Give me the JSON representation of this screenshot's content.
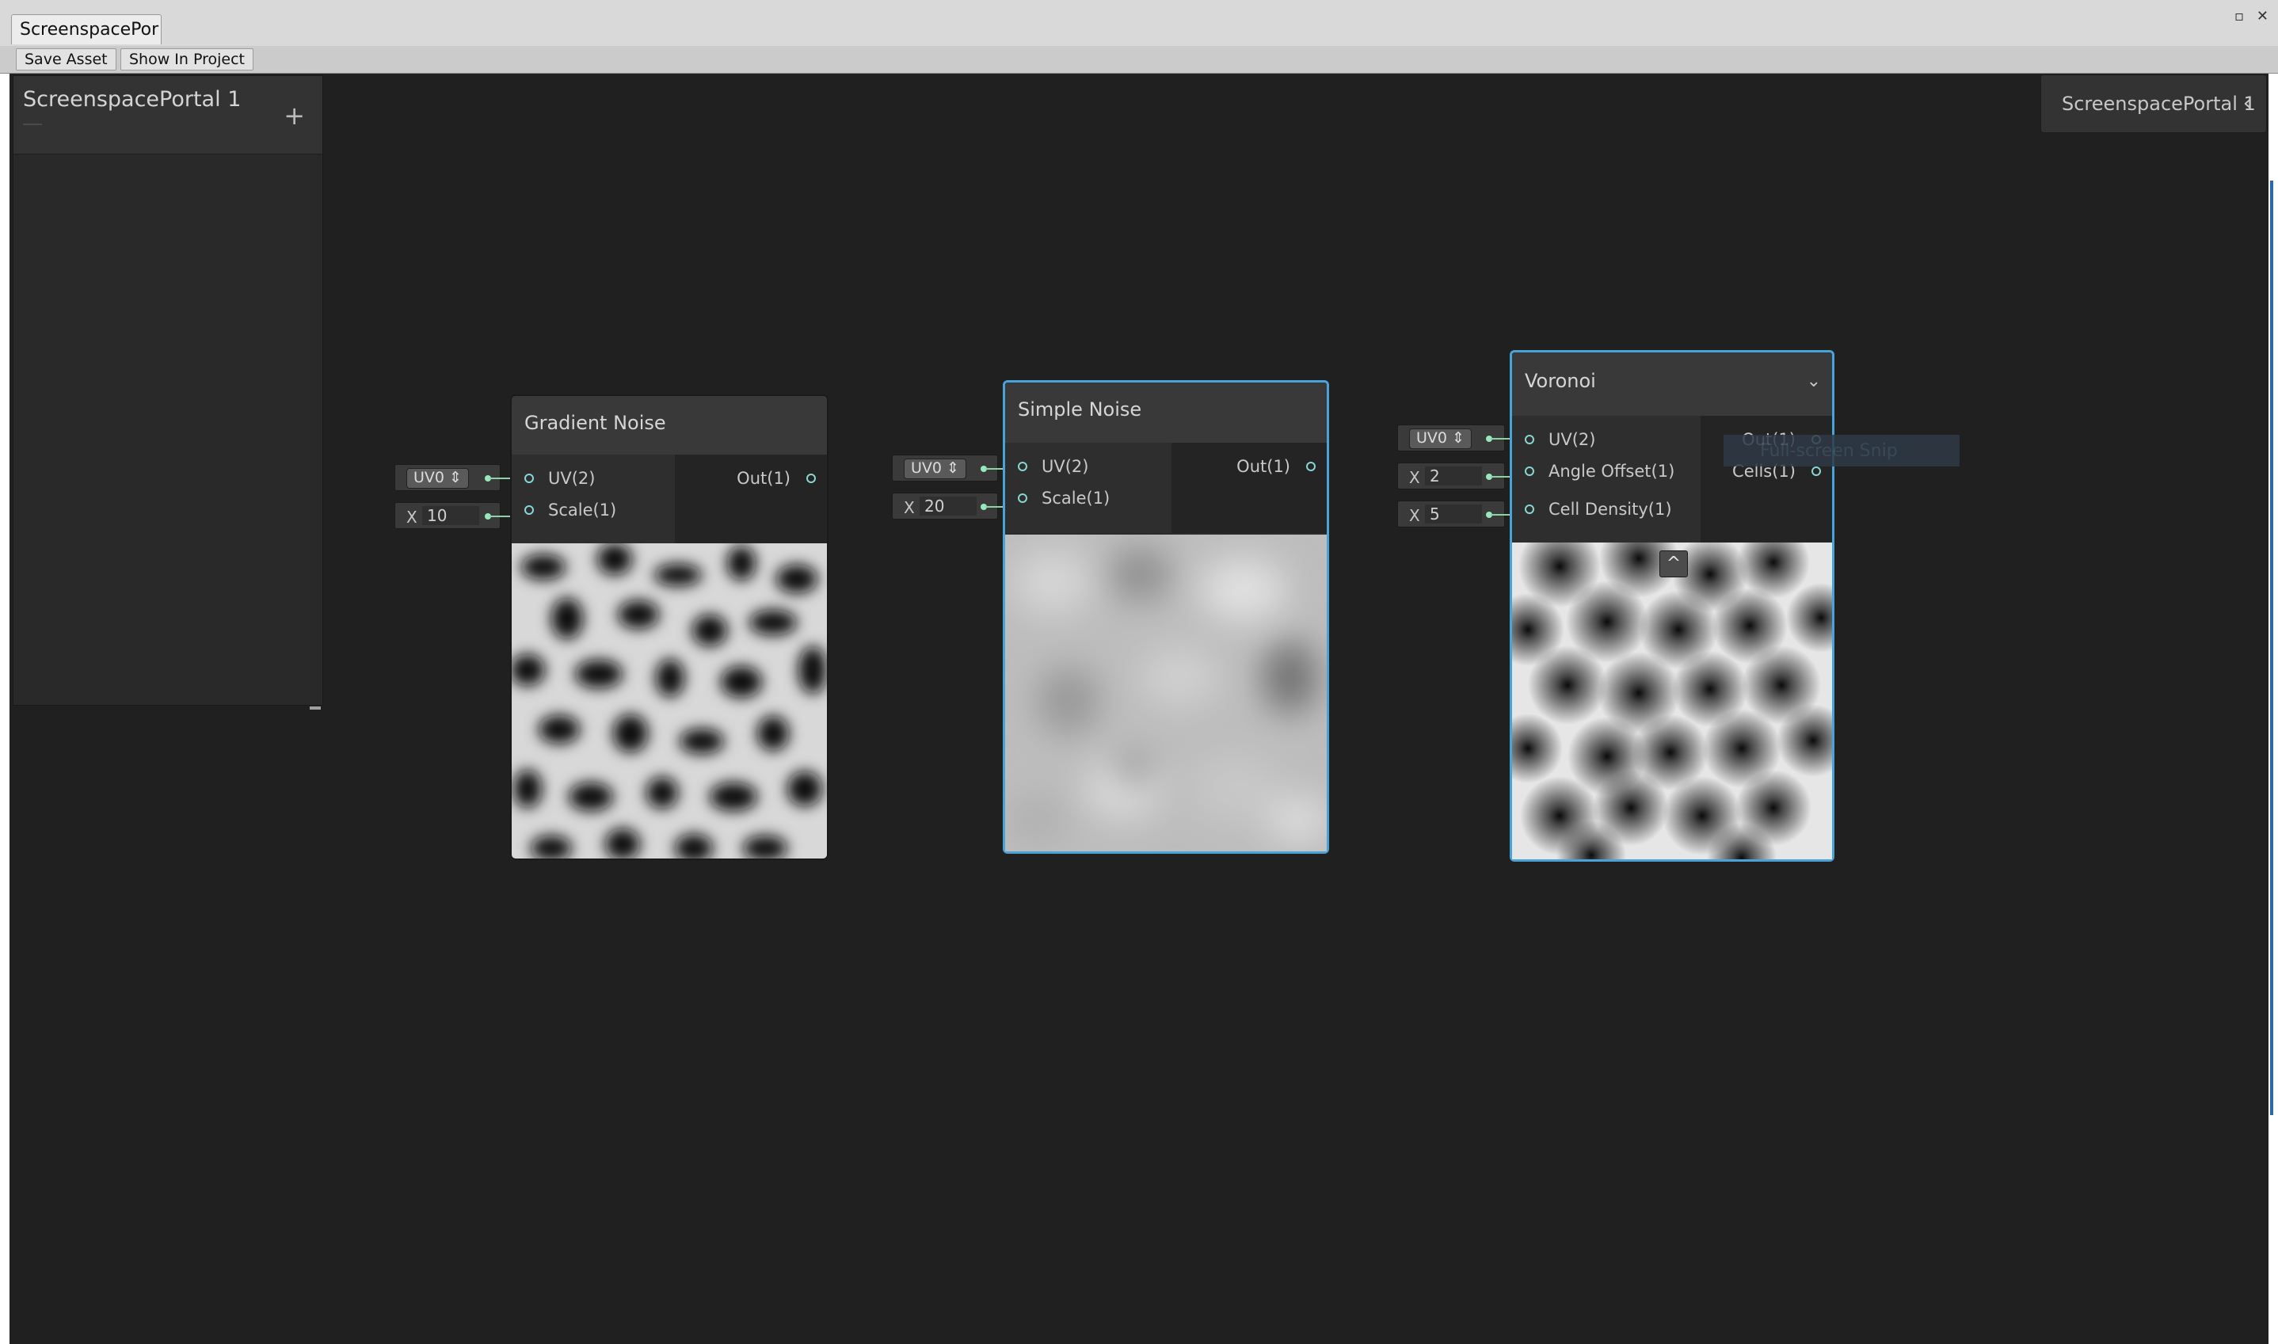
{
  "window": {
    "tab_title": "ScreenspacePor",
    "controls": [
      "▫",
      "✕"
    ]
  },
  "toolbar": {
    "save_label": "Save Asset",
    "show_in_project_label": "Show In Project"
  },
  "blackboard": {
    "title": "ScreenspacePortal 1",
    "add_label": "+"
  },
  "inspector": {
    "label": "ScreenspacePortal 1",
    "chevron": "‹"
  },
  "nodes": {
    "gradient_noise": {
      "title": "Gradient Noise",
      "inputs": [
        "UV(2)",
        "Scale(1)"
      ],
      "outputs": [
        "Out(1)"
      ],
      "uv_value": "UV0 ⇕",
      "scale_axis": "X",
      "scale_value": "10"
    },
    "simple_noise": {
      "title": "Simple Noise",
      "inputs": [
        "UV(2)",
        "Scale(1)"
      ],
      "outputs": [
        "Out(1)"
      ],
      "uv_value": "UV0 ⇕",
      "scale_axis": "X",
      "scale_value": "20"
    },
    "voronoi": {
      "title": "Voronoi",
      "collapse_icon": "⌄",
      "inputs": [
        "UV(2)",
        "Angle Offset(1)",
        "Cell Density(1)"
      ],
      "outputs": [
        "Out(1)",
        "Cells(1)"
      ],
      "uv_value": "UV0 ⇕",
      "angle_axis": "X",
      "angle_value": "2",
      "density_axis": "X",
      "density_value": "5",
      "preview_toggle": "^"
    }
  },
  "colors": {
    "canvas": "#202020",
    "selection": "#4aa3d8",
    "port": "#88d6d6",
    "connection": "#88d6a6"
  },
  "snip_tooltip": "Full-screen Snip"
}
